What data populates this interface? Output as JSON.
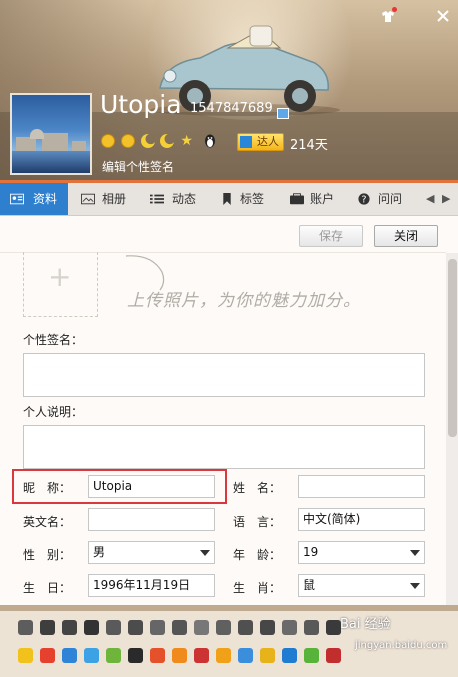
{
  "header": {
    "nickname": "Utopia",
    "qq_number": "1547847689",
    "daren_badge": "达人",
    "days": "214天",
    "edit_signature": "编辑个性签名",
    "level_icons": [
      "sun",
      "sun",
      "moon",
      "moon",
      "star"
    ]
  },
  "tabs": [
    {
      "label": "资料",
      "icon": "profile-card-icon",
      "active": true
    },
    {
      "label": "相册",
      "icon": "photo-album-icon",
      "active": false
    },
    {
      "label": "动态",
      "icon": "feed-list-icon",
      "active": false
    },
    {
      "label": "标签",
      "icon": "bookmark-tag-icon",
      "active": false
    },
    {
      "label": "账户",
      "icon": "wallet-icon",
      "active": false
    },
    {
      "label": "问问",
      "icon": "question-icon",
      "active": false
    }
  ],
  "toolbar": {
    "save_label": "保存",
    "close_label": "关闭"
  },
  "photo": {
    "hint": "上传照片，为你的魅力加分。"
  },
  "form": {
    "signature_label": "个性签名：",
    "description_label": "个人说明：",
    "nickname_label": "昵　称：",
    "nickname_value": "Utopia",
    "surname_label": "姓　名：",
    "surname_value": "",
    "english_name_label": "英文名：",
    "english_name_value": "",
    "language_label": "语　言：",
    "language_value": "中文(简体)",
    "gender_label": "性　别：",
    "gender_value": "男",
    "age_label": "年　龄：",
    "age_value": "19",
    "birthday_label": "生　日：",
    "birthday_value": "1996年11月19日",
    "zodiac_label": "生　肖：",
    "zodiac_value": "鼠"
  },
  "watermark": {
    "text": "Bai 经验",
    "url": "jingyan.baidu.com"
  },
  "colors": {
    "accent_blue": "#2f7fcf",
    "highlight_red": "#d9383f",
    "header_orange_line": "#e2733a"
  }
}
